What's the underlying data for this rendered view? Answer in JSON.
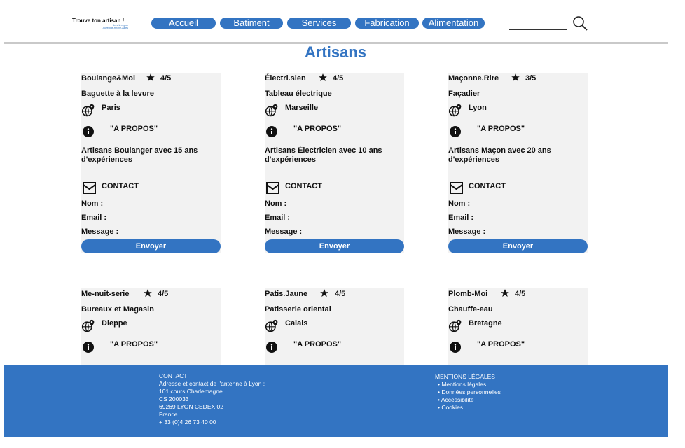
{
  "header": {
    "logo_title": "Trouve ton artisan !",
    "logo_sub1": "Avec la région",
    "logo_sub2": "Auvergne-Rhône-Alpes",
    "nav": [
      "Accueil",
      "Batiment",
      "Services",
      "Fabrication",
      "Alimentation"
    ],
    "search_placeholder": ""
  },
  "page_title": "Artisans",
  "cards": [
    {
      "name": "Boulange&Moi",
      "rating": "4/5",
      "specialty": "Baguette à la levure",
      "city": "Paris",
      "about": "\"A PROPOS\"",
      "desc": "Artisans Boulanger avec 15 ans d'expériences",
      "contact": "CONTACT",
      "nom": "Nom :",
      "email": "Email :",
      "message": "Message :",
      "button": "Envoyer"
    },
    {
      "name": "Électri.sien",
      "rating": "4/5",
      "specialty": "Tableau électrique",
      "city": "Marseille",
      "about": "\"A PROPOS\"",
      "desc": "Artisans Électricien avec 10 ans d'expériences",
      "contact": "CONTACT",
      "nom": "Nom :",
      "email": "Email :",
      "message": "Message :",
      "button": "Envoyer"
    },
    {
      "name": "Maçonne.Rire",
      "rating": "3/5",
      "specialty": "Façadier",
      "city": "Lyon",
      "about": "\"A PROPOS\"",
      "desc": "Artisans Maçon avec  20 ans d'expériences",
      "contact": "CONTACT",
      "nom": "Nom :",
      "email": "Email :",
      "message": "Message :",
      "button": "Envoyer"
    },
    {
      "name": "Me-nuit-serie",
      "rating": "4/5",
      "specialty": "Bureaux et Magasin",
      "city": "Dieppe",
      "about": "\"A PROPOS\""
    },
    {
      "name": "Patis.Jaune",
      "rating": "4/5",
      "specialty": "Patisserie oriental",
      "city": "Calais",
      "about": "\"A PROPOS\""
    },
    {
      "name": "Plomb-Moi",
      "rating": "4/5",
      "specialty": "Chauffe-eau",
      "city": "Bretagne",
      "about": "\"A PROPOS\""
    }
  ],
  "footer": {
    "contact_title": "CONTACT",
    "contact_lines": [
      "Adresse et contact de l'antenne à Lyon :",
      "101 cours Charlemagne",
      "CS 200033",
      "69269 LYON CEDEX 02",
      "France",
      "+ 33 (0)4 26 73 40 00"
    ],
    "legal_title": "MENTIONS LÉGALES",
    "legal_links": [
      "Mentions légales",
      "Données personnelles",
      "Accessibilité",
      "Cookies"
    ]
  },
  "colors": {
    "accent": "#3374c2",
    "card_bg": "#f2f2f2"
  }
}
